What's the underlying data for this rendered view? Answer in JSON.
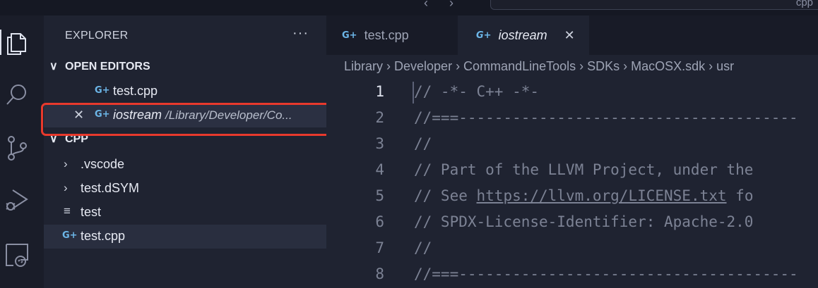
{
  "titlebar": {
    "search_text": "cpp"
  },
  "sidebar": {
    "title": "EXPLORER",
    "more": "···",
    "open_editors": {
      "label": "OPEN EDITORS",
      "items": [
        {
          "name": "test.cpp",
          "path": ""
        },
        {
          "name": "iostream",
          "path": "/Library/Developer/Co..."
        }
      ]
    },
    "folder": {
      "label": "CPP",
      "items": [
        {
          "name": ".vscode",
          "kind": "folder"
        },
        {
          "name": "test.dSYM",
          "kind": "folder"
        },
        {
          "name": "test",
          "kind": "file"
        },
        {
          "name": "test.cpp",
          "kind": "cpp"
        }
      ]
    }
  },
  "tabs": [
    {
      "label": "test.cpp"
    },
    {
      "label": "iostream"
    }
  ],
  "breadcrumb": "Library › Developer › CommandLineTools › SDKs › MacOSX.sdk › usr",
  "code": {
    "lines": [
      {
        "n": "1",
        "text": "// -*- C++ -*-"
      },
      {
        "n": "2",
        "text": "//===--------------------------------------"
      },
      {
        "n": "3",
        "text": "//"
      },
      {
        "n": "4",
        "text": "// Part of the LLVM Project, under the"
      },
      {
        "n": "5",
        "pre": "// See ",
        "link": "https://llvm.org/LICENSE.txt",
        "post": " fo"
      },
      {
        "n": "6",
        "text": "// SPDX-License-Identifier: Apache-2.0"
      },
      {
        "n": "7",
        "text": "//"
      },
      {
        "n": "8",
        "text": "//===--------------------------------------"
      }
    ]
  },
  "colors": {
    "highlight": "#e8392c",
    "cpp_icon": "#6cb6e8"
  }
}
